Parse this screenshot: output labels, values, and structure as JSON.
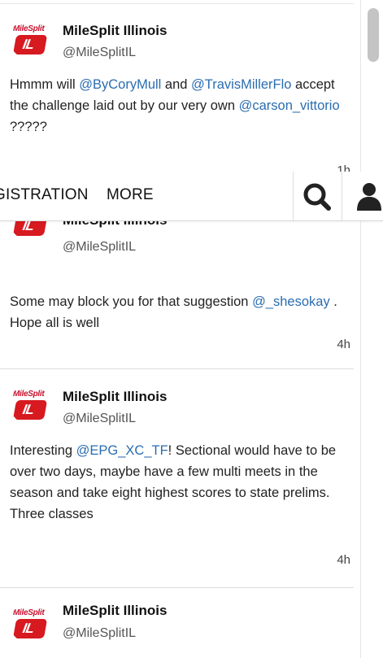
{
  "nav": {
    "registration": "GISTRATION",
    "more": "MORE"
  },
  "tweets": [
    {
      "name": "MileSplit Illinois",
      "handle": "@MileSplitIL",
      "text_parts": [
        "Hmmm will ",
        "@ByCoryMull",
        " and ",
        "@TravisMillerFlo",
        " accept the challenge laid out by our very own ",
        "@carson_vittorio",
        " ?????"
      ],
      "time": "1h"
    },
    {
      "name": "MileSplit Illinois",
      "handle": "@MileSplitIL",
      "text_parts": [
        "Some may block you for that suggestion ",
        "@_shesokay",
        " . Hope all is well"
      ],
      "time": "4h"
    },
    {
      "name": "MileSplit Illinois",
      "handle": "@MileSplitIL",
      "text_parts": [
        "Interesting ",
        "@EPG_XC_TF",
        "! Sectional would have to be over two days, maybe have a few multi meets in the season and take eight highest scores to state prelims. Three classes"
      ],
      "time": "4h"
    },
    {
      "name": "MileSplit Illinois",
      "handle": "@MileSplitIL"
    }
  ],
  "avatar": {
    "logo_text_top": "MileSplit",
    "logo_text_bottom": "IL"
  },
  "icons": {
    "search": "search-icon",
    "user": "user-icon"
  },
  "colors": {
    "link": "#2a6db0",
    "brand_red": "#d71920"
  }
}
